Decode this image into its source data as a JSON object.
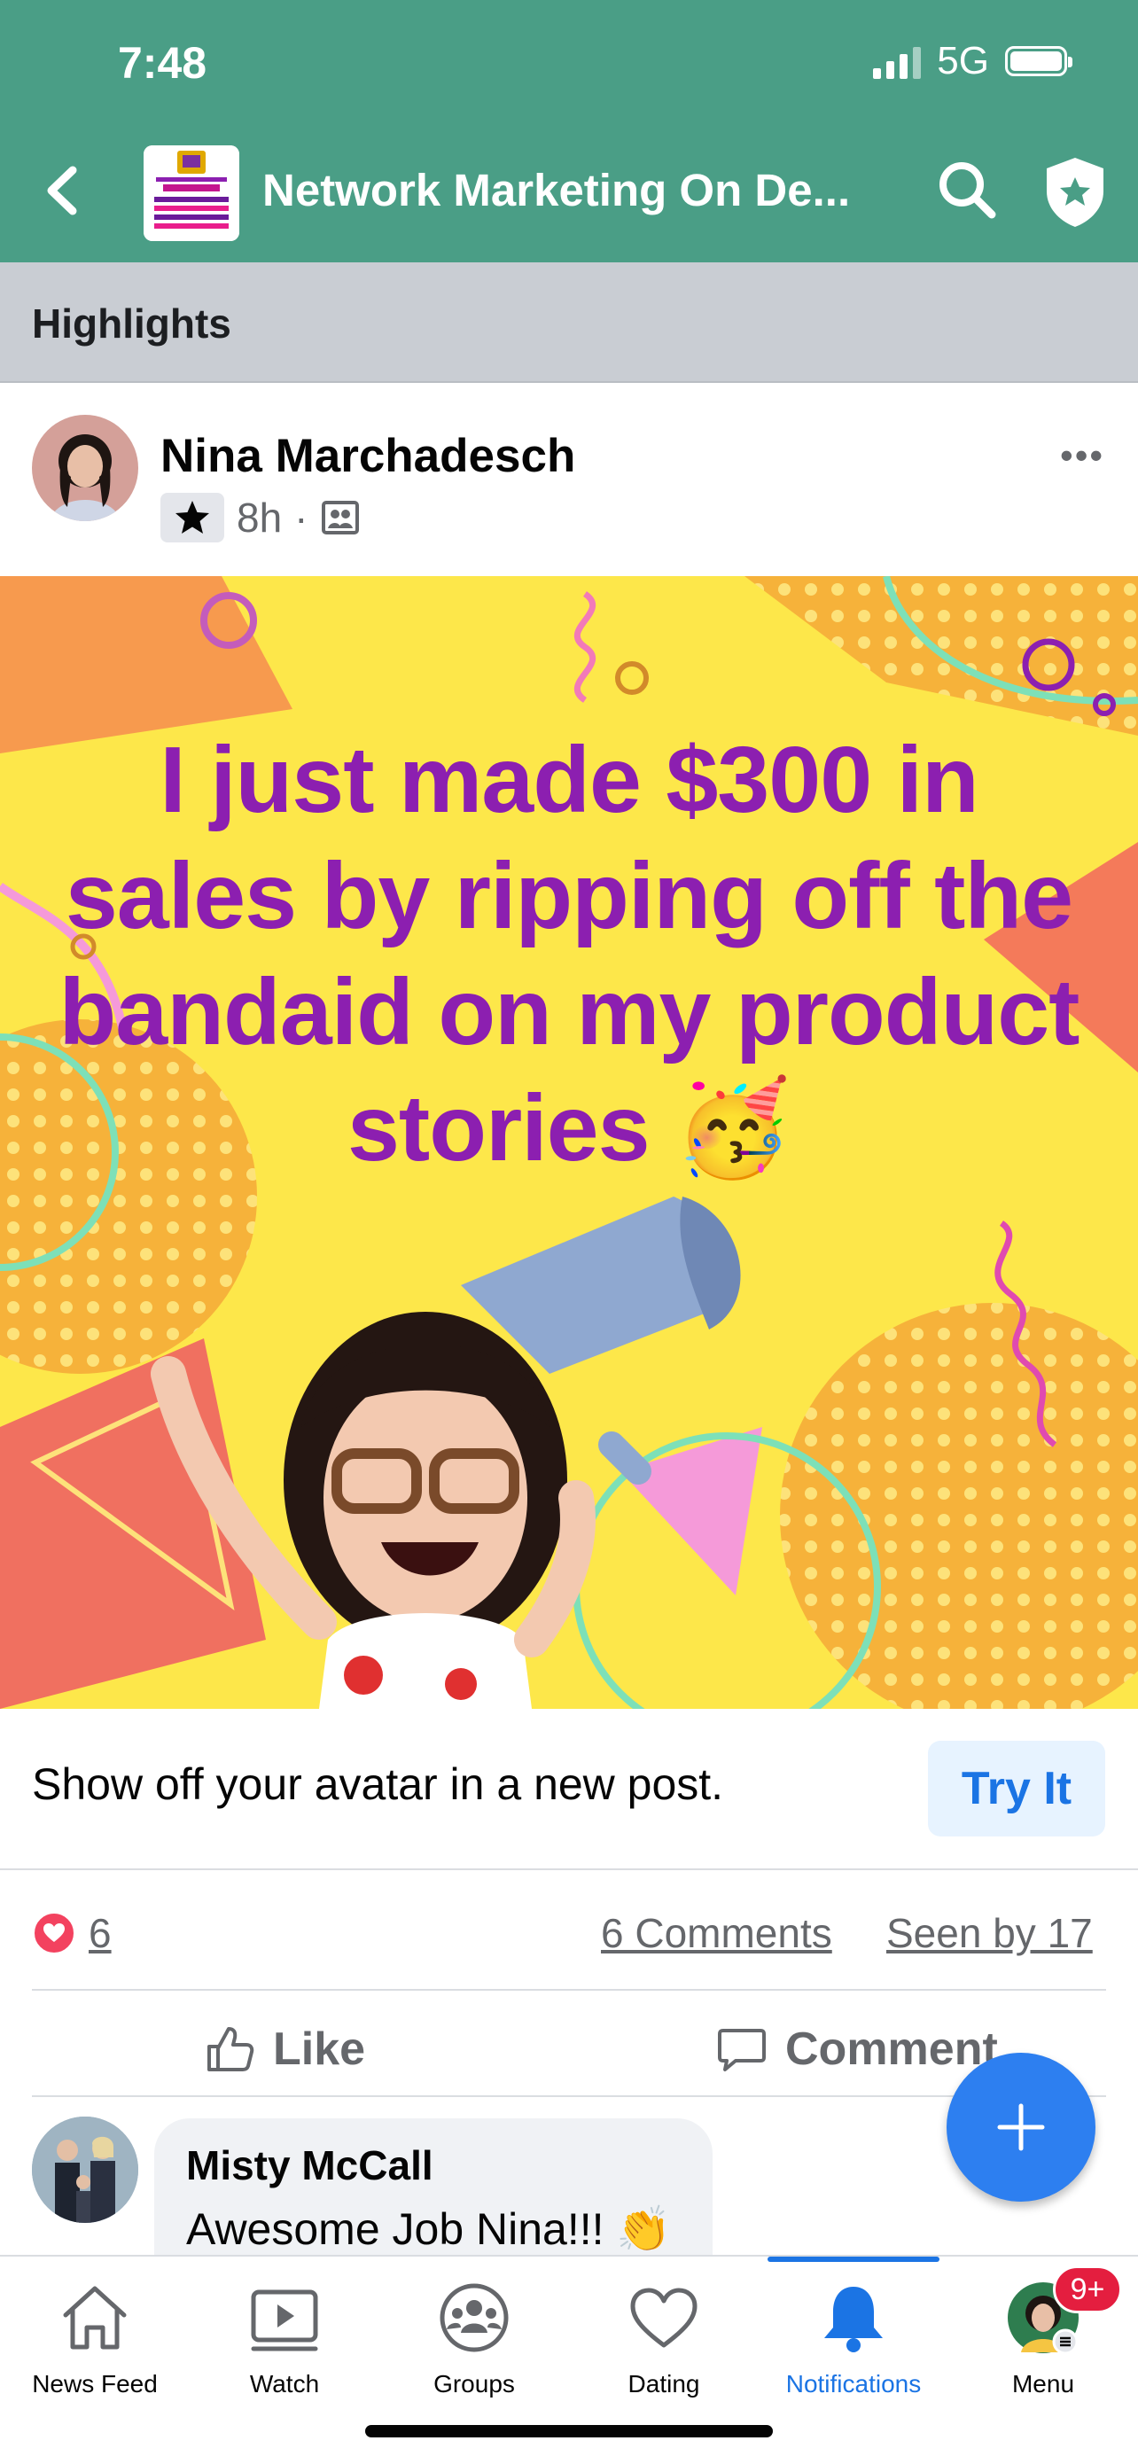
{
  "status_bar": {
    "time": "7:48",
    "network": "5G"
  },
  "header": {
    "group_name": "Network Marketing On De...",
    "back_icon": "chevron-left-icon",
    "search_icon": "search-icon",
    "admin_icon": "shield-star-icon"
  },
  "section": {
    "label": "Highlights"
  },
  "post": {
    "author": "Nina Marchadesch",
    "time": "8h",
    "separator": "·",
    "image_text": "I just made $300 in sales by ripping off the bandaid on my product stories 🥳",
    "more_label": "•••"
  },
  "avatar_prompt": {
    "text": "Show off your avatar in a new post.",
    "button": "Try It"
  },
  "engagement": {
    "reactions": "6",
    "comments": "6 Comments",
    "seen": "Seen by 17"
  },
  "actions": {
    "like": "Like",
    "comment": "Comment"
  },
  "comment": {
    "name": "Misty McCall",
    "text": "Awesome Job Nina!!! 👏"
  },
  "bottom_nav": {
    "items": [
      {
        "label": "News Feed",
        "icon": "home-icon"
      },
      {
        "label": "Watch",
        "icon": "video-icon"
      },
      {
        "label": "Groups",
        "icon": "groups-icon"
      },
      {
        "label": "Dating",
        "icon": "heart-icon"
      },
      {
        "label": "Notifications",
        "icon": "bell-icon"
      },
      {
        "label": "Menu",
        "icon": "profile-avatar-icon"
      }
    ],
    "active": "Notifications",
    "menu_badge": "9+"
  },
  "colors": {
    "header_bg": "#4a9e86",
    "accent": "#1b74e4",
    "post_bg": "#fde74a",
    "post_text": "#8c1fb0",
    "badge": "#e41e3f"
  }
}
